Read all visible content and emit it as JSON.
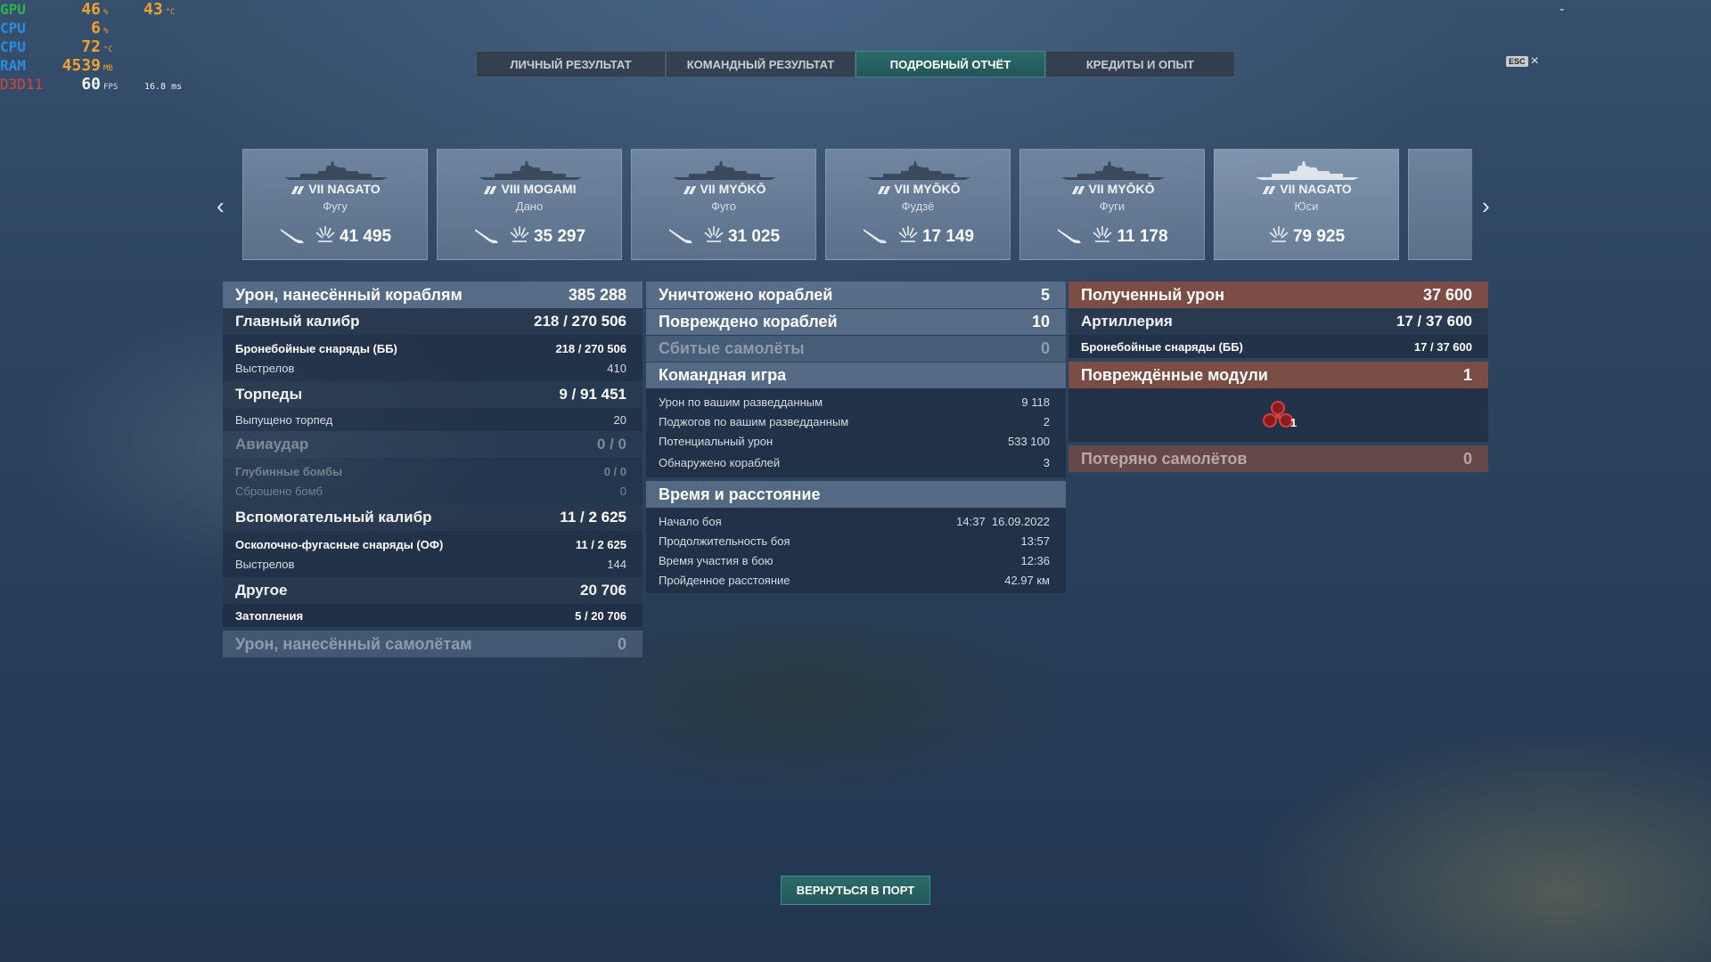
{
  "hw_monitor": [
    {
      "label": "GPU",
      "value": "46",
      "unit": "%",
      "extra": "43",
      "extra_unit": "°C"
    },
    {
      "label": "CPU",
      "value": "6",
      "unit": "%"
    },
    {
      "label": "CPU",
      "value": "72",
      "unit": "°C"
    },
    {
      "label": "RAM",
      "value": "4539",
      "unit": "MB"
    },
    {
      "label": "D3D11",
      "value": "60",
      "unit": "FPS",
      "extra": "16.8 ms"
    }
  ],
  "window": {
    "minimize": "-"
  },
  "tabs": [
    {
      "label": "ЛИЧНЫЙ РЕЗУЛЬТАТ"
    },
    {
      "label": "КОМАНДНЫЙ РЕЗУЛЬТАТ"
    },
    {
      "label": "ПОДРОБНЫЙ ОТЧЁТ",
      "active": true
    },
    {
      "label": "КРЕДИТЫ И ОПЫТ"
    }
  ],
  "esc": {
    "key": "ESC",
    "close": "×"
  },
  "ships": [
    {
      "tier": "VII",
      "name": "NAGATO",
      "player": "Фугу",
      "damage": "41 495"
    },
    {
      "tier": "VIII",
      "name": "MOGAMI",
      "player": "Дано",
      "damage": "35 297"
    },
    {
      "tier": "VII",
      "name": "MYŌKŌ",
      "player": "Фуго",
      "damage": "31 025"
    },
    {
      "tier": "VII",
      "name": "MYŌKŌ",
      "player": "Фудзё",
      "damage": "17 149"
    },
    {
      "tier": "VII",
      "name": "MYŌKŌ",
      "player": "Фуги",
      "damage": "11 178"
    },
    {
      "tier": "VII",
      "name": "NAGATO",
      "player": "Юси",
      "damage": "79 925",
      "self": true
    }
  ],
  "left_panel": {
    "ship_damage": {
      "label": "Урон, нанесённый кораблям",
      "value": "385 288"
    },
    "main_battery": {
      "label": "Главный калибр",
      "hits": "218",
      "value": "270 506"
    },
    "ap_shells": {
      "label": "Бронебойные снаряды (ББ)",
      "hits": "218",
      "value": "270 506"
    },
    "shots_main": {
      "label": "Выстрелов",
      "value": "410"
    },
    "torpedoes": {
      "label": "Торпеды",
      "hits": "9",
      "value": "91 451"
    },
    "torpedoes_fired": {
      "label": "Выпущено торпед",
      "value": "20"
    },
    "airstrike": {
      "label": "Авиаудар",
      "hits": "0",
      "value": "0"
    },
    "depth_charges": {
      "label": "Глубинные бомбы",
      "hits": "0",
      "value": "0"
    },
    "bombs_dropped": {
      "label": "Сброшено бомб",
      "value": "0"
    },
    "secondary": {
      "label": "Вспомогательный калибр",
      "hits": "11",
      "value": "2 625"
    },
    "he_shells": {
      "label": "Осколочно-фугасные снаряды (ОФ)",
      "hits": "11",
      "value": "2 625"
    },
    "shots_secondary": {
      "label": "Выстрелов",
      "value": "144"
    },
    "other": {
      "label": "Другое",
      "value": "20 706"
    },
    "flooding": {
      "label": "Затопления",
      "hits": "5",
      "value": "20 706"
    },
    "plane_damage": {
      "label": "Урон, нанесённый самолётам",
      "value": "0"
    }
  },
  "mid_panel": {
    "destroyed": {
      "label": "Уничтожено кораблей",
      "value": "5"
    },
    "damaged": {
      "label": "Повреждено кораблей",
      "value": "10"
    },
    "planes_shot": {
      "label": "Сбитые самолёты",
      "value": "0"
    },
    "team_play": {
      "label": "Командная игра"
    },
    "spotting_damage": {
      "label": "Урон по вашим разведданным",
      "value": "9 118"
    },
    "spotting_fires": {
      "label": "Поджогов по вашим разведданным",
      "value": "2"
    },
    "potential_damage": {
      "label": "Потенциальный урон",
      "value": "533 100"
    },
    "ships_spotted": {
      "label": "Обнаружено кораблей",
      "value": "3"
    },
    "time_distance": {
      "label": "Время и расстояние"
    },
    "battle_start": {
      "label": "Начало боя",
      "value": "14:37  16.09.2022"
    },
    "battle_duration": {
      "label": "Продолжительность боя",
      "value": "13:57"
    },
    "time_in_battle": {
      "label": "Время участия в бою",
      "value": "12:36"
    },
    "distance": {
      "label": "Пройденное расстояние",
      "value": "42.97 км"
    }
  },
  "right_panel": {
    "damage_received": {
      "label": "Полученный урон",
      "value": "37 600"
    },
    "artillery": {
      "label": "Артиллерия",
      "hits": "17",
      "value": "37 600"
    },
    "ap_received": {
      "label": "Бронебойные снаряды (ББ)",
      "hits": "17",
      "value": "37 600"
    },
    "modules": {
      "label": "Повреждённые модули",
      "value": "1",
      "icon_count": "1"
    },
    "planes_lost": {
      "label": "Потеряно самолётов",
      "value": "0"
    }
  },
  "back_button": {
    "label": "ВЕРНУТЬСЯ В ПОРТ"
  },
  "colors": {
    "accent": "#2b6a6a",
    "received": "#965040"
  }
}
